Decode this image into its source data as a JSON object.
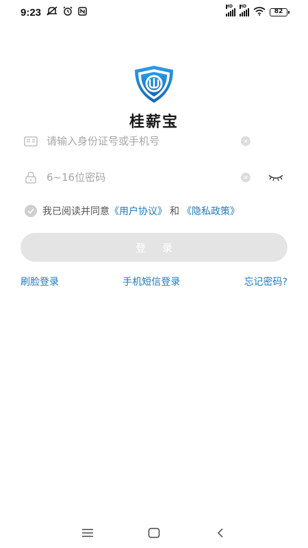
{
  "status": {
    "time": "9:23",
    "battery": "82",
    "hd": "HD"
  },
  "app": {
    "name": "桂薪宝"
  },
  "login": {
    "id_placeholder": "请输入身份证号或手机号",
    "password_placeholder": "6~16位密码",
    "agree_prefix": "我已阅读并同意",
    "user_agreement": "《用户协议》",
    "and": "和",
    "privacy_policy": "《隐私政策》",
    "login_button": "登录",
    "face_login": "刷脸登录",
    "sms_login": "手机短信登录",
    "forgot_password": "忘记密码?"
  },
  "colors": {
    "link": "#1e7bbf",
    "logo_blue": "#1f86d6",
    "button_disabled": "#e4e4e4"
  }
}
